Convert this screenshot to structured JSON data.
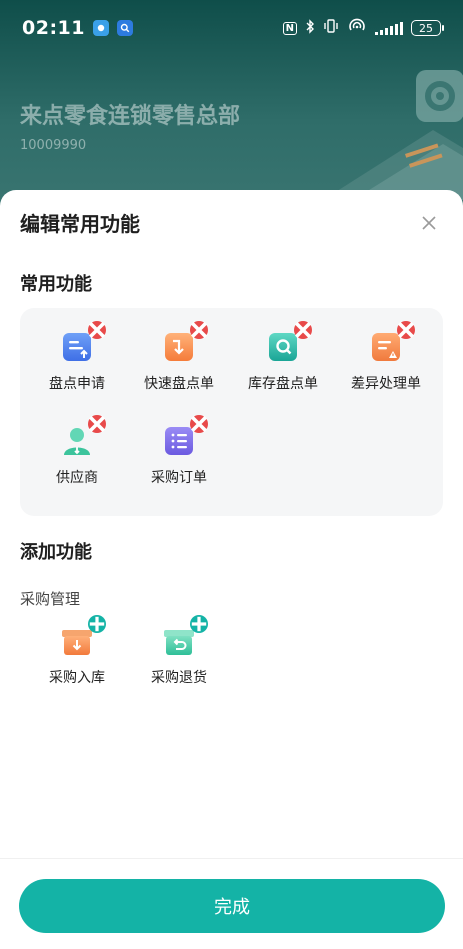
{
  "status_bar": {
    "time": "02:11",
    "nfc": "N",
    "battery": "25",
    "icons": [
      "gallery-app-icon",
      "search-app-icon",
      "nfc-icon",
      "bluetooth-icon",
      "vibrate-icon",
      "hotspot-icon",
      "signal-icon",
      "battery-icon"
    ]
  },
  "background": {
    "store_name": "来点零食连锁零售总部",
    "store_code": "10009990"
  },
  "sheet": {
    "title": "编辑常用功能",
    "close_icon": "close-icon",
    "common_section": {
      "title": "常用功能",
      "items": [
        {
          "label": "盘点申请",
          "icon": "inventory-request-icon",
          "action": "remove"
        },
        {
          "label": "快速盘点单",
          "icon": "quick-inventory-icon",
          "action": "remove"
        },
        {
          "label": "库存盘点单",
          "icon": "stock-inventory-icon",
          "action": "remove"
        },
        {
          "label": "差异处理单",
          "icon": "discrepancy-icon",
          "action": "remove"
        },
        {
          "label": "供应商",
          "icon": "supplier-icon",
          "action": "remove"
        },
        {
          "label": "采购订单",
          "icon": "purchase-order-icon",
          "action": "remove"
        }
      ]
    },
    "add_section": {
      "title": "添加功能",
      "group": "采购管理",
      "items": [
        {
          "label": "采购入库",
          "icon": "purchase-inbound-icon",
          "action": "add"
        },
        {
          "label": "采购退货",
          "icon": "purchase-return-icon",
          "action": "add"
        }
      ]
    },
    "done_label": "完成"
  },
  "colors": {
    "accent": "#14b3a6",
    "remove_badge": "#e84a4a",
    "panel_bg": "#f5f6f7",
    "header_bg": "#2f6d69"
  }
}
